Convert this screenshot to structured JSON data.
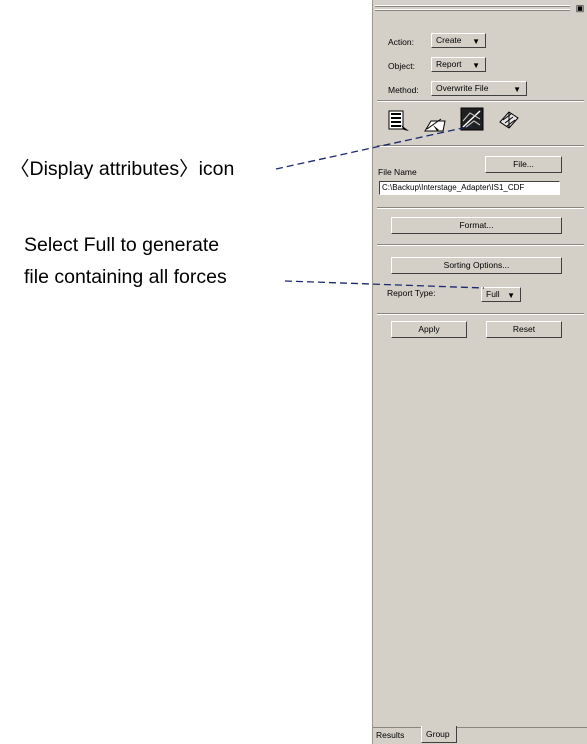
{
  "annotations": {
    "display_attributes": "〈Display attributes〉icon",
    "select_full_line1": "Select Full to generate",
    "select_full_line2": "file containing all forces"
  },
  "panel": {
    "title_button": "▣",
    "action": {
      "label": "Action:",
      "value": "Create"
    },
    "object": {
      "label": "Object:",
      "value": "Report"
    },
    "method": {
      "label": "Method:",
      "value": "Overwrite File"
    },
    "toolbar_icons": [
      "select-entities-icon",
      "display-options-icon",
      "display-attributes-icon",
      "plot-options-icon"
    ],
    "file_name": {
      "label": "File Name",
      "value": "C:\\Backup\\Interstage_Adapter\\IS1_CDF",
      "button": "File..."
    },
    "format_button": "Format...",
    "sorting_button": "Sorting Options...",
    "report_type": {
      "label": "Report Type:",
      "value": "Full"
    },
    "apply_button": "Apply",
    "reset_button": "Reset",
    "tabs": [
      "Results",
      "Group"
    ]
  },
  "colors": {
    "panel_bg": "#d4d0c8",
    "leader_line": "#1a2a6c"
  }
}
